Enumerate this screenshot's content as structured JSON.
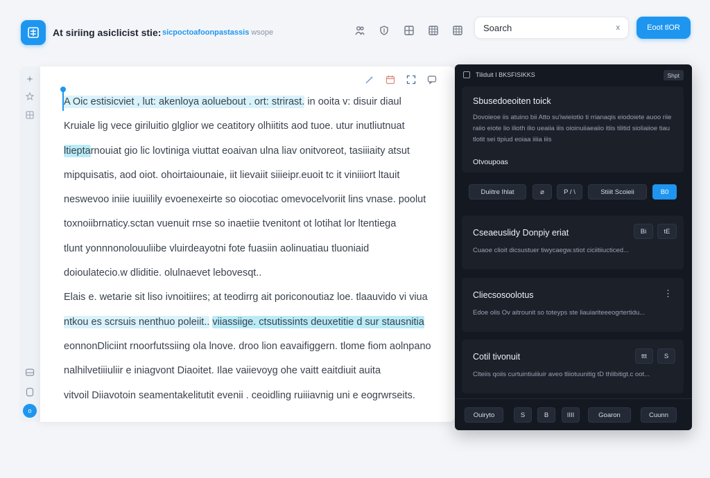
{
  "header": {
    "title": "At siriing asiclicist stie:",
    "subtitle": "sicpoctoafoonpastassis",
    "subtitle_muted": "wsope",
    "toolbar_icons": [
      "people-icon",
      "shield-icon",
      "grid-icon",
      "table-icon",
      "apps-icon"
    ],
    "search": {
      "placeholder": "Soarch",
      "clear_label": "x"
    },
    "primary_button": "Eoot tlOR"
  },
  "rail": {
    "icons": [
      "sparkle-icon",
      "star-icon",
      "layout-icon",
      "archive-icon",
      "database-icon"
    ],
    "badge": "o"
  },
  "document": {
    "tool_icons": [
      "wand-icon",
      "calendar-icon",
      "expand-icon",
      "comment-icon"
    ],
    "lines": [
      {
        "parts": [
          {
            "text": "A Oic estisicviet , lut: akenloya  aoluebout . ort:  strirast.",
            "hl": true
          },
          {
            "text": " in ooita v: disuir  diaul",
            "hl": false
          }
        ]
      },
      {
        "parts": [
          {
            "text": "Kruiale lig vece giriluitio glglior we ceatitory olhiitits aod tuoe. utur inutliutnuat",
            "hl": false
          }
        ]
      },
      {
        "parts": [
          {
            "text": "ltiepta",
            "hl": "strong"
          },
          {
            "text": "rnouiat gio lic lovtiniga viuttat eoaivan ulna liav onitvoreot, tasiiiaity atsut",
            "hl": false
          }
        ]
      },
      {
        "parts": [
          {
            "text": "mipquisatis, aod oiot. ohoirtaiounaie, iit lievaiit siiieipr.euoit tc it viniiiort ltauit",
            "hl": false
          }
        ]
      },
      {
        "parts": [
          {
            "text": "neswevoo iniie iuuiilily evoenexeirte so oiocotiac omevocelvoriit lins vnase. poolut",
            "hl": false
          }
        ]
      },
      {
        "parts": [
          {
            "text": "toxnoiibrnaticy.sctan vuenuit rnse so inaetiie tvenitont ot lotihat lor ltentiega",
            "hl": false
          }
        ]
      },
      {
        "parts": [
          {
            "text": "tlunt  yonnnonolouuliibe  vluirdeayotni  fote fuasiin aolinuatiau tluoniaid",
            "hl": false
          }
        ]
      },
      {
        "parts": [
          {
            "text": "doioulatecio.w dliditie. olulnaevet lebovesqt..",
            "hl": false
          }
        ]
      },
      {
        "parts": [
          {
            "text": "Elais  e. wetarie sit  liso ivnoitiires; at teodirrg ait poriconoutiaz loe. tlaauvido vi viua",
            "hl": false
          }
        ]
      },
      {
        "parts": [
          {
            "text": "ntkou es  scrsuis  nenthuo  poleiit..",
            "hl": true
          },
          {
            "text": " ",
            "hl": false
          },
          {
            "text": "viiassiige. ctsutissints  deuxetitie  d  sur  stausnitia",
            "hl": "strong"
          }
        ]
      },
      {
        "parts": [
          {
            "text": "eonnonDliciint rnoorfutssiing ola lnove. droo lion eavaifiggern.  tlome fiom aolnpano",
            "hl": false
          }
        ]
      },
      {
        "parts": [
          {
            "text": "nalhilvetiiiuliir e iniagvont Diaoitet. Ilae vaiievoyg ohe vaitt eaitdiuit auita",
            "hl": false
          }
        ]
      },
      {
        "parts": [
          {
            "text": "vitvoil Diiavotoin seamentakelitutit evenii . ceoidling ruiiiavnig uni e eogrwrseits.",
            "hl": false
          }
        ]
      }
    ]
  },
  "panel": {
    "header_title": "Tiliduit I BKSFISIKKS",
    "header_button": "Shpt",
    "card1": {
      "title": "Sbusedoeoiten toick",
      "text": "Dovoieoe iis atuino bii Atto su'iwieiotio ti rrianaqis eiodoiete auoo riie raiio eiote lio ilioth ilio ueaiia iiis oioinuiiaeaiio itiis tilitid sioliaiioe tiau tlotit sei tipiud eoiaa iiiia iiis",
      "footer_label": "Otvoupoas",
      "chips": [
        "Duiitre  Ihlat",
        "⌀",
        "P / \\",
        "Stiiit  Scoieii",
        "B0"
      ]
    },
    "card2": {
      "title": "Cseaeuslidy Donpiy eriat",
      "text": "Cuaoe clioit dicsustuer tiwycaegw.stiot  ciciitiiucticed...",
      "chips": [
        "Bi",
        "tE"
      ]
    },
    "card3": {
      "title": "Cliecsosoolotus",
      "text": "Edoe olis Ov aitrounit so toteyps ste liauiariteeeogrtertidu...",
      "menu": "⋮"
    },
    "card4": {
      "title": "Cotil tivonuit",
      "text": "Clteiis qoiis curtuintiuiiiuir aveo tliiotuunitig tD thlibitigt.c oot...",
      "chips": [
        "ttt",
        "S"
      ]
    },
    "footer": [
      "Ouiryto",
      "S",
      "B",
      "IIII",
      "Goaron",
      "Cuunn"
    ]
  }
}
